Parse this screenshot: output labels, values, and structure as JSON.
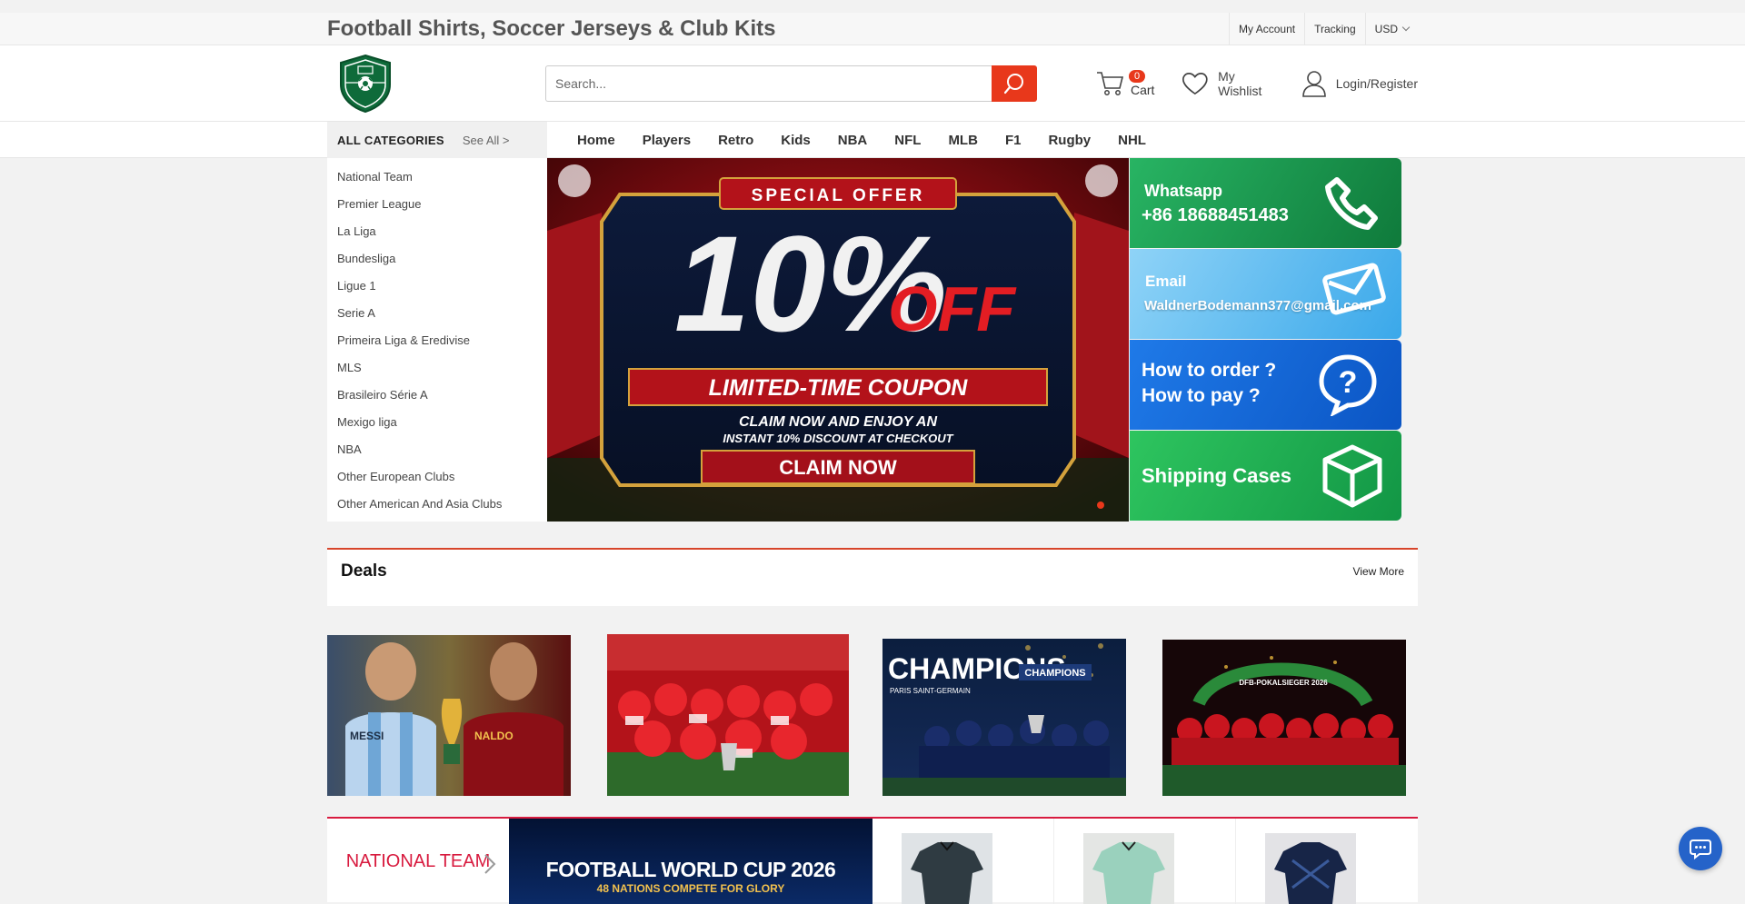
{
  "site": {
    "title": "Football Shirts, Soccer Jerseys & Club Kits"
  },
  "toplinks": {
    "account": "My Account",
    "tracking": "Tracking",
    "currency": "USD"
  },
  "search": {
    "placeholder": "Search..."
  },
  "cart": {
    "count": "0",
    "label": "Cart"
  },
  "wishlist": {
    "label": "My Wishlist"
  },
  "login": {
    "label": "Login/Register"
  },
  "nav": {
    "all_categories": "ALL CATEGORIES",
    "see_all": "See All >",
    "items": [
      "Home",
      "Players",
      "Retro",
      "Kids",
      "NBA",
      "NFL",
      "MLB",
      "F1",
      "Rugby",
      "NHL"
    ]
  },
  "categories": [
    "National Team",
    "Premier League",
    "La Liga",
    "Bundesliga",
    "Ligue 1",
    "Serie A",
    "Primeira Liga & Eredivise",
    "MLS",
    "Brasileiro Série  A",
    "Mexigo liga",
    "NBA",
    "Other European Clubs",
    "Other American And Asia Clubs"
  ],
  "banner": {
    "special": "SPECIAL OFFER",
    "big": "10%",
    "off": "OFF",
    "coupon": "LIMITED-TIME COUPON",
    "line1": "CLAIM NOW AND ENJOY AN",
    "line2": "INSTANT 10% DISCOUNT AT CHECKOUT",
    "cta": "CLAIM NOW"
  },
  "side_tiles": {
    "whatsapp_label": "Whatsapp",
    "whatsapp_number": "+86 18688451483",
    "email_label": "Email",
    "email_address": "WaldnerBodemann377@gmail.com",
    "howto_line1": "How to order ?",
    "howto_line2": "How to pay ?",
    "shipping": "Shipping Cases"
  },
  "deals": {
    "title": "Deals",
    "view_more": "View More",
    "img1_text": [
      "MESSI",
      "NALDO"
    ],
    "img3_title": "CHAMPIONS",
    "img3_sub": "PARIS SAINT-GERMAIN",
    "img3_badge": "CHAMPIONS",
    "img4_arch": "DFB-POKALSIEGER 2026"
  },
  "national": {
    "title": "NATIONAL TEAM",
    "banner_title": "FOOTBALL WORLD CUP 2026",
    "banner_sub": "48 NATIONS COMPETE FOR GLORY"
  },
  "colors": {
    "accent": "#e8381b",
    "brand_green": "#0e6b3a",
    "national": "#d81b3f",
    "chat": "#2563c9"
  }
}
